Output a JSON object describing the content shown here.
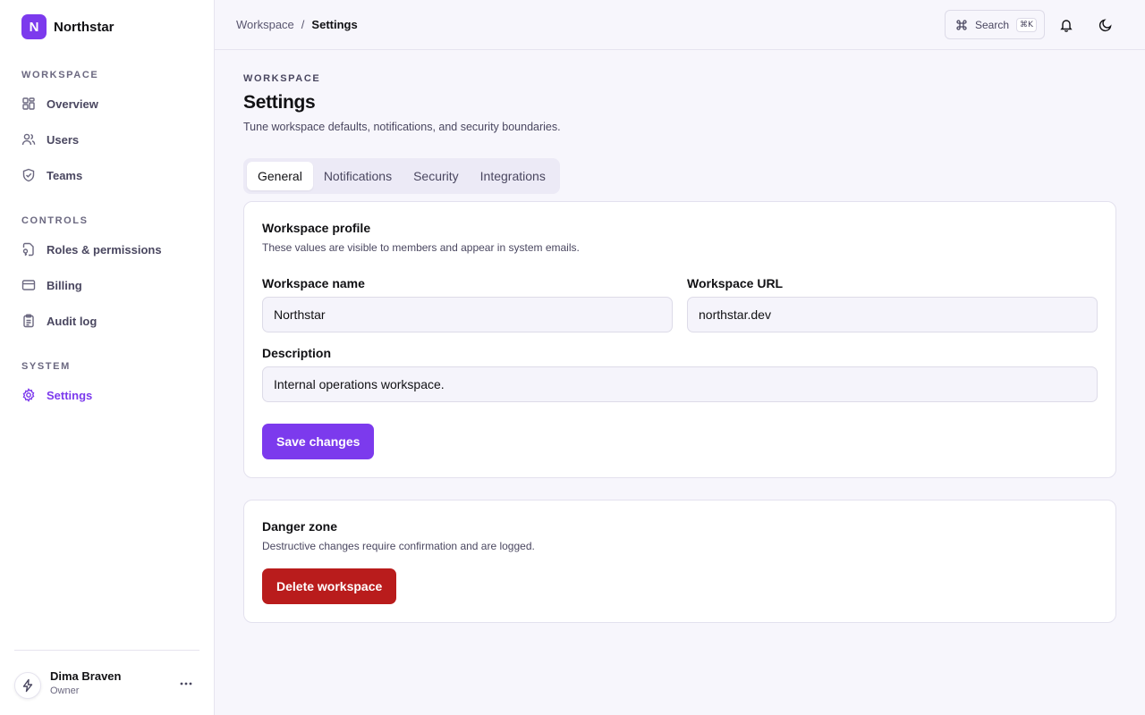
{
  "brand": {
    "logo_letter": "N",
    "name": "Northstar",
    "accent": "#7c3aed"
  },
  "sidebar": {
    "sections": [
      {
        "heading": "WORKSPACE",
        "items": [
          {
            "label": "Overview",
            "icon": "grid-icon"
          },
          {
            "label": "Users",
            "icon": "users-icon"
          },
          {
            "label": "Teams",
            "icon": "shield-icon"
          }
        ]
      },
      {
        "heading": "CONTROLS",
        "items": [
          {
            "label": "Roles & permissions",
            "icon": "key-file-icon"
          },
          {
            "label": "Billing",
            "icon": "credit-card-icon"
          },
          {
            "label": "Audit log",
            "icon": "clipboard-icon"
          }
        ]
      },
      {
        "heading": "SYSTEM",
        "items": [
          {
            "label": "Settings",
            "icon": "gear-icon",
            "active": true
          }
        ]
      }
    ],
    "user": {
      "name": "Dima Braven",
      "role": "Owner",
      "avatar_icon": "lightning-icon"
    }
  },
  "topbar": {
    "breadcrumb": {
      "parent": "Workspace",
      "separator": "/",
      "current": "Settings"
    },
    "search": {
      "label": "Search",
      "shortcut": "⌘K"
    }
  },
  "page": {
    "eyebrow": "WORKSPACE",
    "title": "Settings",
    "subtitle": "Tune workspace defaults, notifications, and security boundaries.",
    "tabs": [
      {
        "label": "General",
        "active": true
      },
      {
        "label": "Notifications"
      },
      {
        "label": "Security"
      },
      {
        "label": "Integrations"
      }
    ]
  },
  "profile_card": {
    "title": "Workspace profile",
    "subtitle": "These values are visible to members and appear in system emails.",
    "name_label": "Workspace name",
    "name_value": "Northstar",
    "url_label": "Workspace URL",
    "url_value": "northstar.dev",
    "description_label": "Description",
    "description_value": "Internal operations workspace.",
    "save_label": "Save changes"
  },
  "danger_card": {
    "title": "Danger zone",
    "subtitle": "Destructive changes require confirmation and are logged.",
    "delete_label": "Delete workspace",
    "danger_color": "#b91c1c"
  }
}
